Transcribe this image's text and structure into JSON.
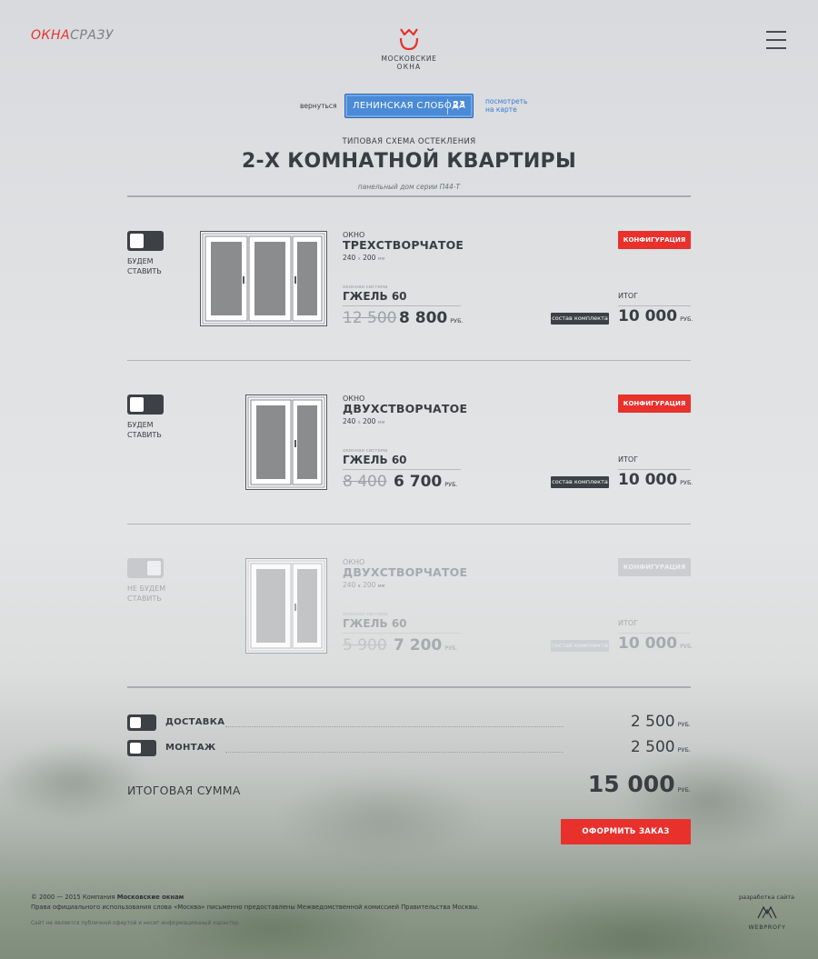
{
  "header": {
    "logo_left_part1": "ОКНА",
    "logo_left_part2": "СРАЗУ",
    "brand_line1": "МОСКОВСКИЕ",
    "brand_line2": "ОКНА",
    "menu_icon": "hamburger-icon"
  },
  "nav": {
    "back_label": "вернуться",
    "metro_station": "ЛЕНИНСКАЯ СЛОБОДА",
    "metro_number": "23",
    "map_link_line1": "посмотреть",
    "map_link_line2": "на карте"
  },
  "heading": {
    "kicker": "ТИПОВАЯ СХЕМА ОСТЕКЛЕНИЯ",
    "title": "2-Х КОМНАТНОЙ КВАРТИРЫ",
    "subtitle": "панельный дом серии П44-Т"
  },
  "items": [
    {
      "toggle_label_1": "БУДЕМ",
      "toggle_label_2": "СТАВИТЬ",
      "type": "ОКНО",
      "name": "ТРЕХСТВОРЧАТОЕ",
      "size": "240",
      "size_x": "x",
      "size2": "200",
      "size_unit": "мм",
      "system_label": "оконная система",
      "system_name": "ГЖЕЛЬ 60",
      "old_price": "12 500",
      "new_price": "8 800",
      "currency": "РУБ.",
      "config_label": "КОНФИГУРАЦИЯ",
      "total_label": "ИТОГ",
      "kit_label": "состав комплекта",
      "total": "10 000",
      "enabled": true
    },
    {
      "toggle_label_1": "БУДЕМ",
      "toggle_label_2": "СТАВИТЬ",
      "type": "ОКНО",
      "name": "ДВУХСТВОРЧАТОЕ",
      "size": "240",
      "size_x": "x",
      "size2": "200",
      "size_unit": "мм",
      "system_label": "оконная система",
      "system_name": "ГЖЕЛЬ 60",
      "old_price": "8 400",
      "new_price": "6 700",
      "currency": "РУБ.",
      "config_label": "КОНФИГУРАЦИЯ",
      "total_label": "ИТОГ",
      "kit_label": "состав комплекта",
      "total": "10 000",
      "enabled": true
    },
    {
      "toggle_label_1": "НЕ БУДЕМ",
      "toggle_label_2": "СТАВИТЬ",
      "type": "ОКНО",
      "name": "ДВУХСТВОРЧАТОЕ",
      "size": "240",
      "size_x": "x",
      "size2": "200",
      "size_unit": "мм",
      "system_label": "оконная система",
      "system_name": "ГЖЕЛЬ 60",
      "old_price": "5 900",
      "new_price": "7 200",
      "currency": "РУБ.",
      "config_label": "КОНФИГУРАЦИЯ",
      "total_label": "ИТОГ",
      "kit_label": "состав комплекта",
      "total": "10 000",
      "enabled": false
    }
  ],
  "services": [
    {
      "label": "ДОСТАВКА",
      "price": "2 500",
      "currency": "РУБ."
    },
    {
      "label": "МОНТАЖ",
      "price": "2 500",
      "currency": "РУБ."
    }
  ],
  "grand_total": {
    "label": "ИТОГОВАЯ СУММА",
    "value": "15 000",
    "currency": "РУБ."
  },
  "order_button": "ОФОРМИТЬ ЗАКАЗ",
  "footer": {
    "copyright_prefix": "© 2000 — 2015 Компания",
    "company": "Московские окнам",
    "rights": "Права официального использования слова «Москва» письменно предоставлены Межведомственной комиссией Правительства Москвы.",
    "disclaimer": "Сайт не является публичной офертой и носит информационный характер.",
    "developer_label": "разработка сайта",
    "developer_name": "WEBPROFY"
  },
  "colors": {
    "accent_red": "#e8312c",
    "metro_blue": "#4a8ad6",
    "text_dark": "#3a3d42"
  }
}
